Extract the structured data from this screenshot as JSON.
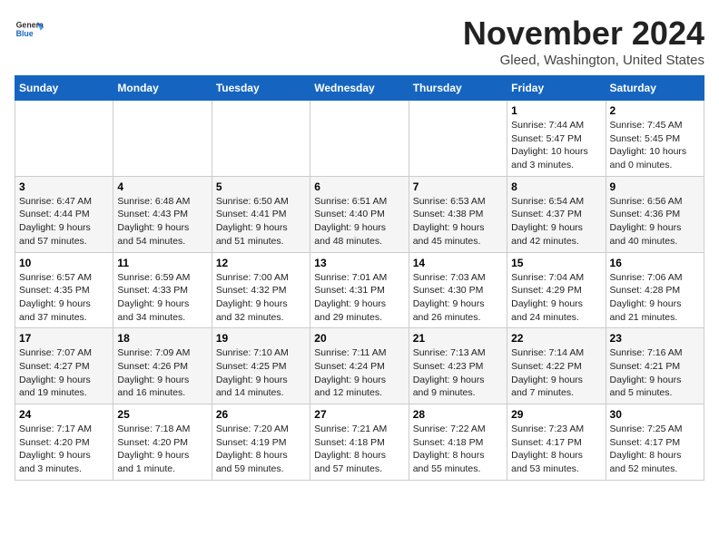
{
  "header": {
    "logo_general": "General",
    "logo_blue": "Blue",
    "month_title": "November 2024",
    "location": "Gleed, Washington, United States"
  },
  "weekdays": [
    "Sunday",
    "Monday",
    "Tuesday",
    "Wednesday",
    "Thursday",
    "Friday",
    "Saturday"
  ],
  "weeks": [
    [
      {
        "day": "",
        "info": ""
      },
      {
        "day": "",
        "info": ""
      },
      {
        "day": "",
        "info": ""
      },
      {
        "day": "",
        "info": ""
      },
      {
        "day": "",
        "info": ""
      },
      {
        "day": "1",
        "info": "Sunrise: 7:44 AM\nSunset: 5:47 PM\nDaylight: 10 hours\nand 3 minutes."
      },
      {
        "day": "2",
        "info": "Sunrise: 7:45 AM\nSunset: 5:45 PM\nDaylight: 10 hours\nand 0 minutes."
      }
    ],
    [
      {
        "day": "3",
        "info": "Sunrise: 6:47 AM\nSunset: 4:44 PM\nDaylight: 9 hours\nand 57 minutes."
      },
      {
        "day": "4",
        "info": "Sunrise: 6:48 AM\nSunset: 4:43 PM\nDaylight: 9 hours\nand 54 minutes."
      },
      {
        "day": "5",
        "info": "Sunrise: 6:50 AM\nSunset: 4:41 PM\nDaylight: 9 hours\nand 51 minutes."
      },
      {
        "day": "6",
        "info": "Sunrise: 6:51 AM\nSunset: 4:40 PM\nDaylight: 9 hours\nand 48 minutes."
      },
      {
        "day": "7",
        "info": "Sunrise: 6:53 AM\nSunset: 4:38 PM\nDaylight: 9 hours\nand 45 minutes."
      },
      {
        "day": "8",
        "info": "Sunrise: 6:54 AM\nSunset: 4:37 PM\nDaylight: 9 hours\nand 42 minutes."
      },
      {
        "day": "9",
        "info": "Sunrise: 6:56 AM\nSunset: 4:36 PM\nDaylight: 9 hours\nand 40 minutes."
      }
    ],
    [
      {
        "day": "10",
        "info": "Sunrise: 6:57 AM\nSunset: 4:35 PM\nDaylight: 9 hours\nand 37 minutes."
      },
      {
        "day": "11",
        "info": "Sunrise: 6:59 AM\nSunset: 4:33 PM\nDaylight: 9 hours\nand 34 minutes."
      },
      {
        "day": "12",
        "info": "Sunrise: 7:00 AM\nSunset: 4:32 PM\nDaylight: 9 hours\nand 32 minutes."
      },
      {
        "day": "13",
        "info": "Sunrise: 7:01 AM\nSunset: 4:31 PM\nDaylight: 9 hours\nand 29 minutes."
      },
      {
        "day": "14",
        "info": "Sunrise: 7:03 AM\nSunset: 4:30 PM\nDaylight: 9 hours\nand 26 minutes."
      },
      {
        "day": "15",
        "info": "Sunrise: 7:04 AM\nSunset: 4:29 PM\nDaylight: 9 hours\nand 24 minutes."
      },
      {
        "day": "16",
        "info": "Sunrise: 7:06 AM\nSunset: 4:28 PM\nDaylight: 9 hours\nand 21 minutes."
      }
    ],
    [
      {
        "day": "17",
        "info": "Sunrise: 7:07 AM\nSunset: 4:27 PM\nDaylight: 9 hours\nand 19 minutes."
      },
      {
        "day": "18",
        "info": "Sunrise: 7:09 AM\nSunset: 4:26 PM\nDaylight: 9 hours\nand 16 minutes."
      },
      {
        "day": "19",
        "info": "Sunrise: 7:10 AM\nSunset: 4:25 PM\nDaylight: 9 hours\nand 14 minutes."
      },
      {
        "day": "20",
        "info": "Sunrise: 7:11 AM\nSunset: 4:24 PM\nDaylight: 9 hours\nand 12 minutes."
      },
      {
        "day": "21",
        "info": "Sunrise: 7:13 AM\nSunset: 4:23 PM\nDaylight: 9 hours\nand 9 minutes."
      },
      {
        "day": "22",
        "info": "Sunrise: 7:14 AM\nSunset: 4:22 PM\nDaylight: 9 hours\nand 7 minutes."
      },
      {
        "day": "23",
        "info": "Sunrise: 7:16 AM\nSunset: 4:21 PM\nDaylight: 9 hours\nand 5 minutes."
      }
    ],
    [
      {
        "day": "24",
        "info": "Sunrise: 7:17 AM\nSunset: 4:20 PM\nDaylight: 9 hours\nand 3 minutes."
      },
      {
        "day": "25",
        "info": "Sunrise: 7:18 AM\nSunset: 4:20 PM\nDaylight: 9 hours\nand 1 minute."
      },
      {
        "day": "26",
        "info": "Sunrise: 7:20 AM\nSunset: 4:19 PM\nDaylight: 8 hours\nand 59 minutes."
      },
      {
        "day": "27",
        "info": "Sunrise: 7:21 AM\nSunset: 4:18 PM\nDaylight: 8 hours\nand 57 minutes."
      },
      {
        "day": "28",
        "info": "Sunrise: 7:22 AM\nSunset: 4:18 PM\nDaylight: 8 hours\nand 55 minutes."
      },
      {
        "day": "29",
        "info": "Sunrise: 7:23 AM\nSunset: 4:17 PM\nDaylight: 8 hours\nand 53 minutes."
      },
      {
        "day": "30",
        "info": "Sunrise: 7:25 AM\nSunset: 4:17 PM\nDaylight: 8 hours\nand 52 minutes."
      }
    ]
  ]
}
